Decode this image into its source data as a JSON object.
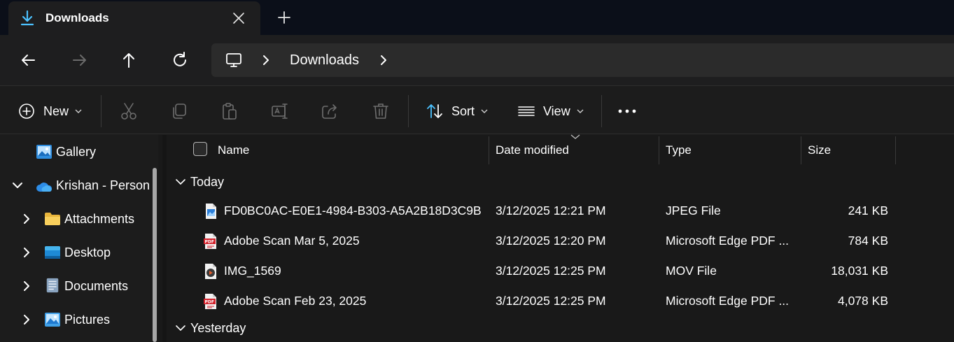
{
  "tab": {
    "title": "Downloads",
    "icon": "download-icon",
    "accent": "#4cc2ff"
  },
  "nav": {
    "back": "back-arrow-icon",
    "forward": "forward-arrow-icon",
    "up": "up-arrow-icon",
    "refresh": "refresh-icon",
    "address": {
      "root_icon": "this-pc-icon",
      "segments": [
        "Downloads"
      ]
    }
  },
  "toolbar": {
    "new_label": "New",
    "sort_label": "Sort",
    "view_label": "View",
    "icons": [
      "cut-icon",
      "copy-icon",
      "paste-icon",
      "rename-icon",
      "share-icon",
      "delete-icon",
      "more-options-icon"
    ]
  },
  "sidebar": {
    "items": [
      {
        "label": "Gallery",
        "icon": "gallery-icon",
        "expandable": false
      },
      {
        "label": "Krishan - Person",
        "icon": "onedrive-cloud-icon",
        "expanded": true
      },
      {
        "label": "Attachments",
        "icon": "folder-icon",
        "expanded": false
      },
      {
        "label": "Desktop",
        "icon": "desktop-icon",
        "expanded": false
      },
      {
        "label": "Documents",
        "icon": "documents-icon",
        "expanded": false
      },
      {
        "label": "Pictures",
        "icon": "pictures-icon",
        "expanded": false
      }
    ]
  },
  "columns": {
    "name": "Name",
    "date": "Date modified",
    "type": "Type",
    "size": "Size"
  },
  "groups": [
    {
      "label": "Today",
      "expanded": true,
      "files": [
        {
          "name": "FD0BC0AC-E0E1-4984-B303-A5A2B18D3C9B",
          "date": "3/12/2025 12:21 PM",
          "type": "JPEG File",
          "size": "241 KB",
          "icon": "jpeg-image-icon"
        },
        {
          "name": "Adobe Scan Mar 5, 2025",
          "date": "3/12/2025 12:20 PM",
          "type": "Microsoft Edge PDF ...",
          "size": "784 KB",
          "icon": "pdf-icon"
        },
        {
          "name": "IMG_1569",
          "date": "3/12/2025 12:25 PM",
          "type": "MOV File",
          "size": "18,031 KB",
          "icon": "video-icon"
        },
        {
          "name": "Adobe Scan Feb 23, 2025",
          "date": "3/12/2025 12:25 PM",
          "type": "Microsoft Edge PDF ...",
          "size": "4,078 KB",
          "icon": "pdf-icon"
        }
      ]
    },
    {
      "label": "Yesterday",
      "expanded": true,
      "files": []
    }
  ]
}
